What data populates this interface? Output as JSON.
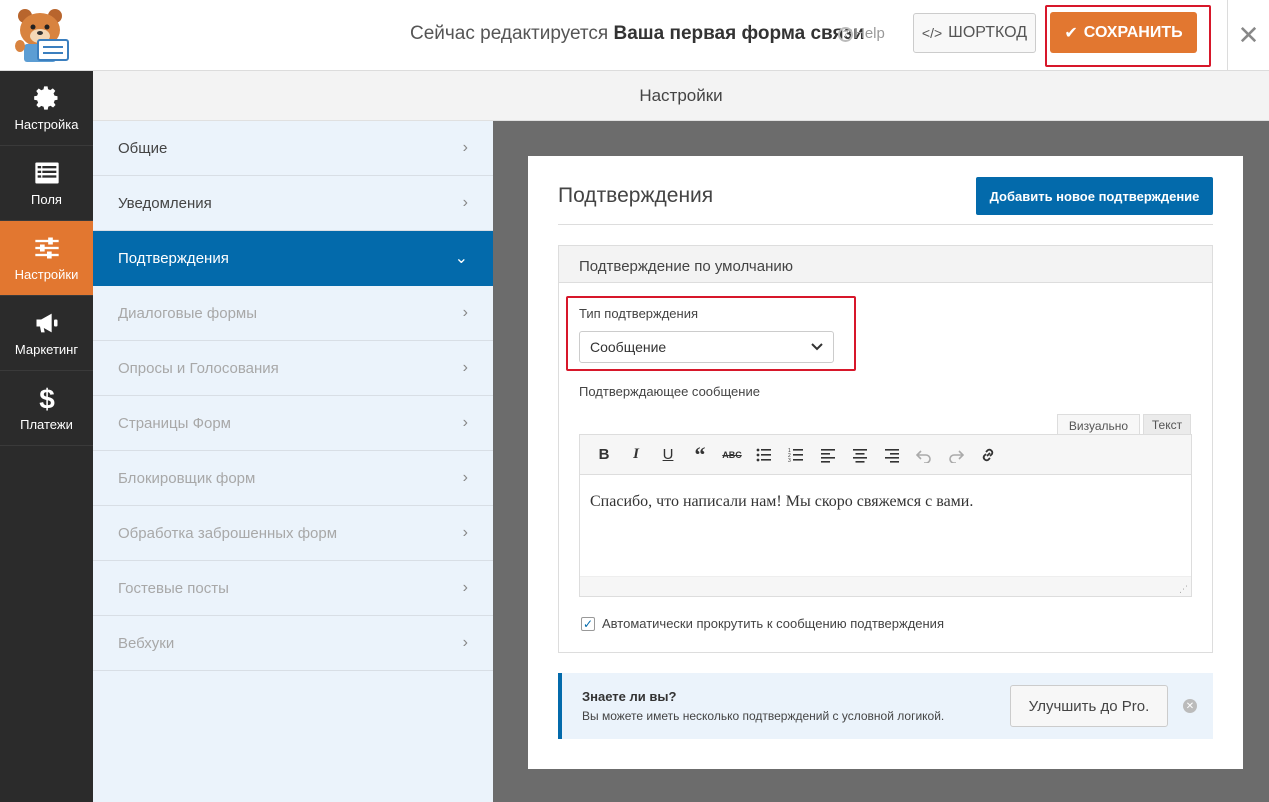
{
  "header": {
    "editing_prefix": "Сейчас редактируется",
    "form_name": "Ваша первая форма связи",
    "help_label": "Help",
    "shortcode_label": "ШОРТКОД",
    "save_label": "СОХРАНИТЬ",
    "close_glyph": "✕"
  },
  "sidebar": {
    "items": [
      {
        "label": "Настройка",
        "icon": "gear-icon"
      },
      {
        "label": "Поля",
        "icon": "fields-icon"
      },
      {
        "label": "Настройки",
        "icon": "sliders-icon",
        "active": true
      },
      {
        "label": "Маркетинг",
        "icon": "megaphone-icon"
      },
      {
        "label": "Платежи",
        "icon": "dollar-icon"
      }
    ]
  },
  "settings_header": "Настройки",
  "subnav": {
    "items": [
      {
        "label": "Общие"
      },
      {
        "label": "Уведомления"
      },
      {
        "label": "Подтверждения",
        "active": true
      },
      {
        "label": "Диалоговые формы",
        "disabled": true
      },
      {
        "label": "Опросы и Голосования",
        "disabled": true
      },
      {
        "label": "Страницы Форм",
        "disabled": true
      },
      {
        "label": "Блокировщик форм",
        "disabled": true
      },
      {
        "label": "Обработка заброшенных форм",
        "disabled": true
      },
      {
        "label": "Гостевые посты",
        "disabled": true
      },
      {
        "label": "Вебхуки",
        "disabled": true
      }
    ]
  },
  "panel": {
    "title": "Подтверждения",
    "add_button": "Добавить новое подтверждение",
    "default_head": "Подтверждение по умолчанию",
    "type_label": "Тип подтверждения",
    "type_value": "Сообщение",
    "message_label": "Подтверждающее сообщение",
    "tab_visual": "Визуально",
    "tab_text": "Текст",
    "message_text": "Спасибо, что написали нам! Мы скоро свяжемся с вами.",
    "auto_scroll_label": "Автоматически прокрутить к сообщению подтверждения"
  },
  "notice": {
    "title": "Знаете ли вы?",
    "text": "Вы можете иметь несколько подтверждений с условной логикой.",
    "upgrade_label": "Улучшить до Pro."
  },
  "colors": {
    "accent_orange": "#e27730",
    "primary_blue": "#036aab",
    "highlight_red": "#d7172a",
    "sidebar_dark": "#2b2b2b"
  }
}
